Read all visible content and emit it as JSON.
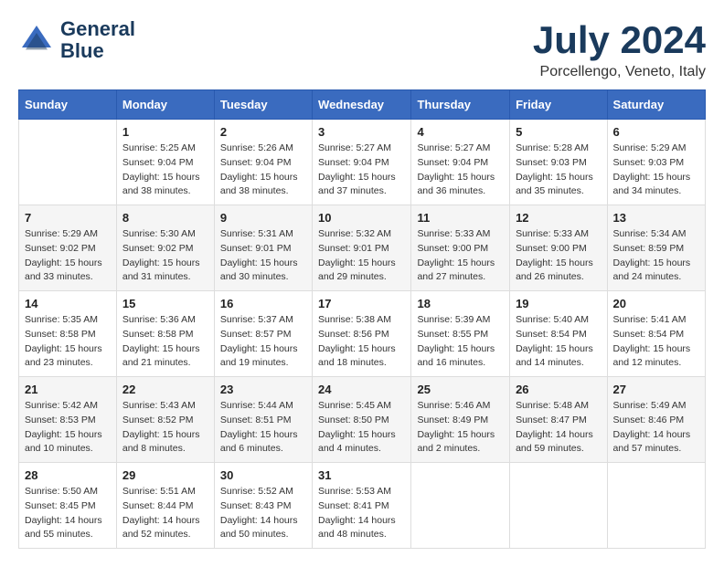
{
  "header": {
    "logo_line1": "General",
    "logo_line2": "Blue",
    "month_title": "July 2024",
    "subtitle": "Porcellengo, Veneto, Italy"
  },
  "days_of_week": [
    "Sunday",
    "Monday",
    "Tuesday",
    "Wednesday",
    "Thursday",
    "Friday",
    "Saturday"
  ],
  "weeks": [
    [
      {
        "day": "",
        "info": ""
      },
      {
        "day": "1",
        "info": "Sunrise: 5:25 AM\nSunset: 9:04 PM\nDaylight: 15 hours\nand 38 minutes."
      },
      {
        "day": "2",
        "info": "Sunrise: 5:26 AM\nSunset: 9:04 PM\nDaylight: 15 hours\nand 38 minutes."
      },
      {
        "day": "3",
        "info": "Sunrise: 5:27 AM\nSunset: 9:04 PM\nDaylight: 15 hours\nand 37 minutes."
      },
      {
        "day": "4",
        "info": "Sunrise: 5:27 AM\nSunset: 9:04 PM\nDaylight: 15 hours\nand 36 minutes."
      },
      {
        "day": "5",
        "info": "Sunrise: 5:28 AM\nSunset: 9:03 PM\nDaylight: 15 hours\nand 35 minutes."
      },
      {
        "day": "6",
        "info": "Sunrise: 5:29 AM\nSunset: 9:03 PM\nDaylight: 15 hours\nand 34 minutes."
      }
    ],
    [
      {
        "day": "7",
        "info": "Sunrise: 5:29 AM\nSunset: 9:02 PM\nDaylight: 15 hours\nand 33 minutes."
      },
      {
        "day": "8",
        "info": "Sunrise: 5:30 AM\nSunset: 9:02 PM\nDaylight: 15 hours\nand 31 minutes."
      },
      {
        "day": "9",
        "info": "Sunrise: 5:31 AM\nSunset: 9:01 PM\nDaylight: 15 hours\nand 30 minutes."
      },
      {
        "day": "10",
        "info": "Sunrise: 5:32 AM\nSunset: 9:01 PM\nDaylight: 15 hours\nand 29 minutes."
      },
      {
        "day": "11",
        "info": "Sunrise: 5:33 AM\nSunset: 9:00 PM\nDaylight: 15 hours\nand 27 minutes."
      },
      {
        "day": "12",
        "info": "Sunrise: 5:33 AM\nSunset: 9:00 PM\nDaylight: 15 hours\nand 26 minutes."
      },
      {
        "day": "13",
        "info": "Sunrise: 5:34 AM\nSunset: 8:59 PM\nDaylight: 15 hours\nand 24 minutes."
      }
    ],
    [
      {
        "day": "14",
        "info": "Sunrise: 5:35 AM\nSunset: 8:58 PM\nDaylight: 15 hours\nand 23 minutes."
      },
      {
        "day": "15",
        "info": "Sunrise: 5:36 AM\nSunset: 8:58 PM\nDaylight: 15 hours\nand 21 minutes."
      },
      {
        "day": "16",
        "info": "Sunrise: 5:37 AM\nSunset: 8:57 PM\nDaylight: 15 hours\nand 19 minutes."
      },
      {
        "day": "17",
        "info": "Sunrise: 5:38 AM\nSunset: 8:56 PM\nDaylight: 15 hours\nand 18 minutes."
      },
      {
        "day": "18",
        "info": "Sunrise: 5:39 AM\nSunset: 8:55 PM\nDaylight: 15 hours\nand 16 minutes."
      },
      {
        "day": "19",
        "info": "Sunrise: 5:40 AM\nSunset: 8:54 PM\nDaylight: 15 hours\nand 14 minutes."
      },
      {
        "day": "20",
        "info": "Sunrise: 5:41 AM\nSunset: 8:54 PM\nDaylight: 15 hours\nand 12 minutes."
      }
    ],
    [
      {
        "day": "21",
        "info": "Sunrise: 5:42 AM\nSunset: 8:53 PM\nDaylight: 15 hours\nand 10 minutes."
      },
      {
        "day": "22",
        "info": "Sunrise: 5:43 AM\nSunset: 8:52 PM\nDaylight: 15 hours\nand 8 minutes."
      },
      {
        "day": "23",
        "info": "Sunrise: 5:44 AM\nSunset: 8:51 PM\nDaylight: 15 hours\nand 6 minutes."
      },
      {
        "day": "24",
        "info": "Sunrise: 5:45 AM\nSunset: 8:50 PM\nDaylight: 15 hours\nand 4 minutes."
      },
      {
        "day": "25",
        "info": "Sunrise: 5:46 AM\nSunset: 8:49 PM\nDaylight: 15 hours\nand 2 minutes."
      },
      {
        "day": "26",
        "info": "Sunrise: 5:48 AM\nSunset: 8:47 PM\nDaylight: 14 hours\nand 59 minutes."
      },
      {
        "day": "27",
        "info": "Sunrise: 5:49 AM\nSunset: 8:46 PM\nDaylight: 14 hours\nand 57 minutes."
      }
    ],
    [
      {
        "day": "28",
        "info": "Sunrise: 5:50 AM\nSunset: 8:45 PM\nDaylight: 14 hours\nand 55 minutes."
      },
      {
        "day": "29",
        "info": "Sunrise: 5:51 AM\nSunset: 8:44 PM\nDaylight: 14 hours\nand 52 minutes."
      },
      {
        "day": "30",
        "info": "Sunrise: 5:52 AM\nSunset: 8:43 PM\nDaylight: 14 hours\nand 50 minutes."
      },
      {
        "day": "31",
        "info": "Sunrise: 5:53 AM\nSunset: 8:41 PM\nDaylight: 14 hours\nand 48 minutes."
      },
      {
        "day": "",
        "info": ""
      },
      {
        "day": "",
        "info": ""
      },
      {
        "day": "",
        "info": ""
      }
    ]
  ]
}
